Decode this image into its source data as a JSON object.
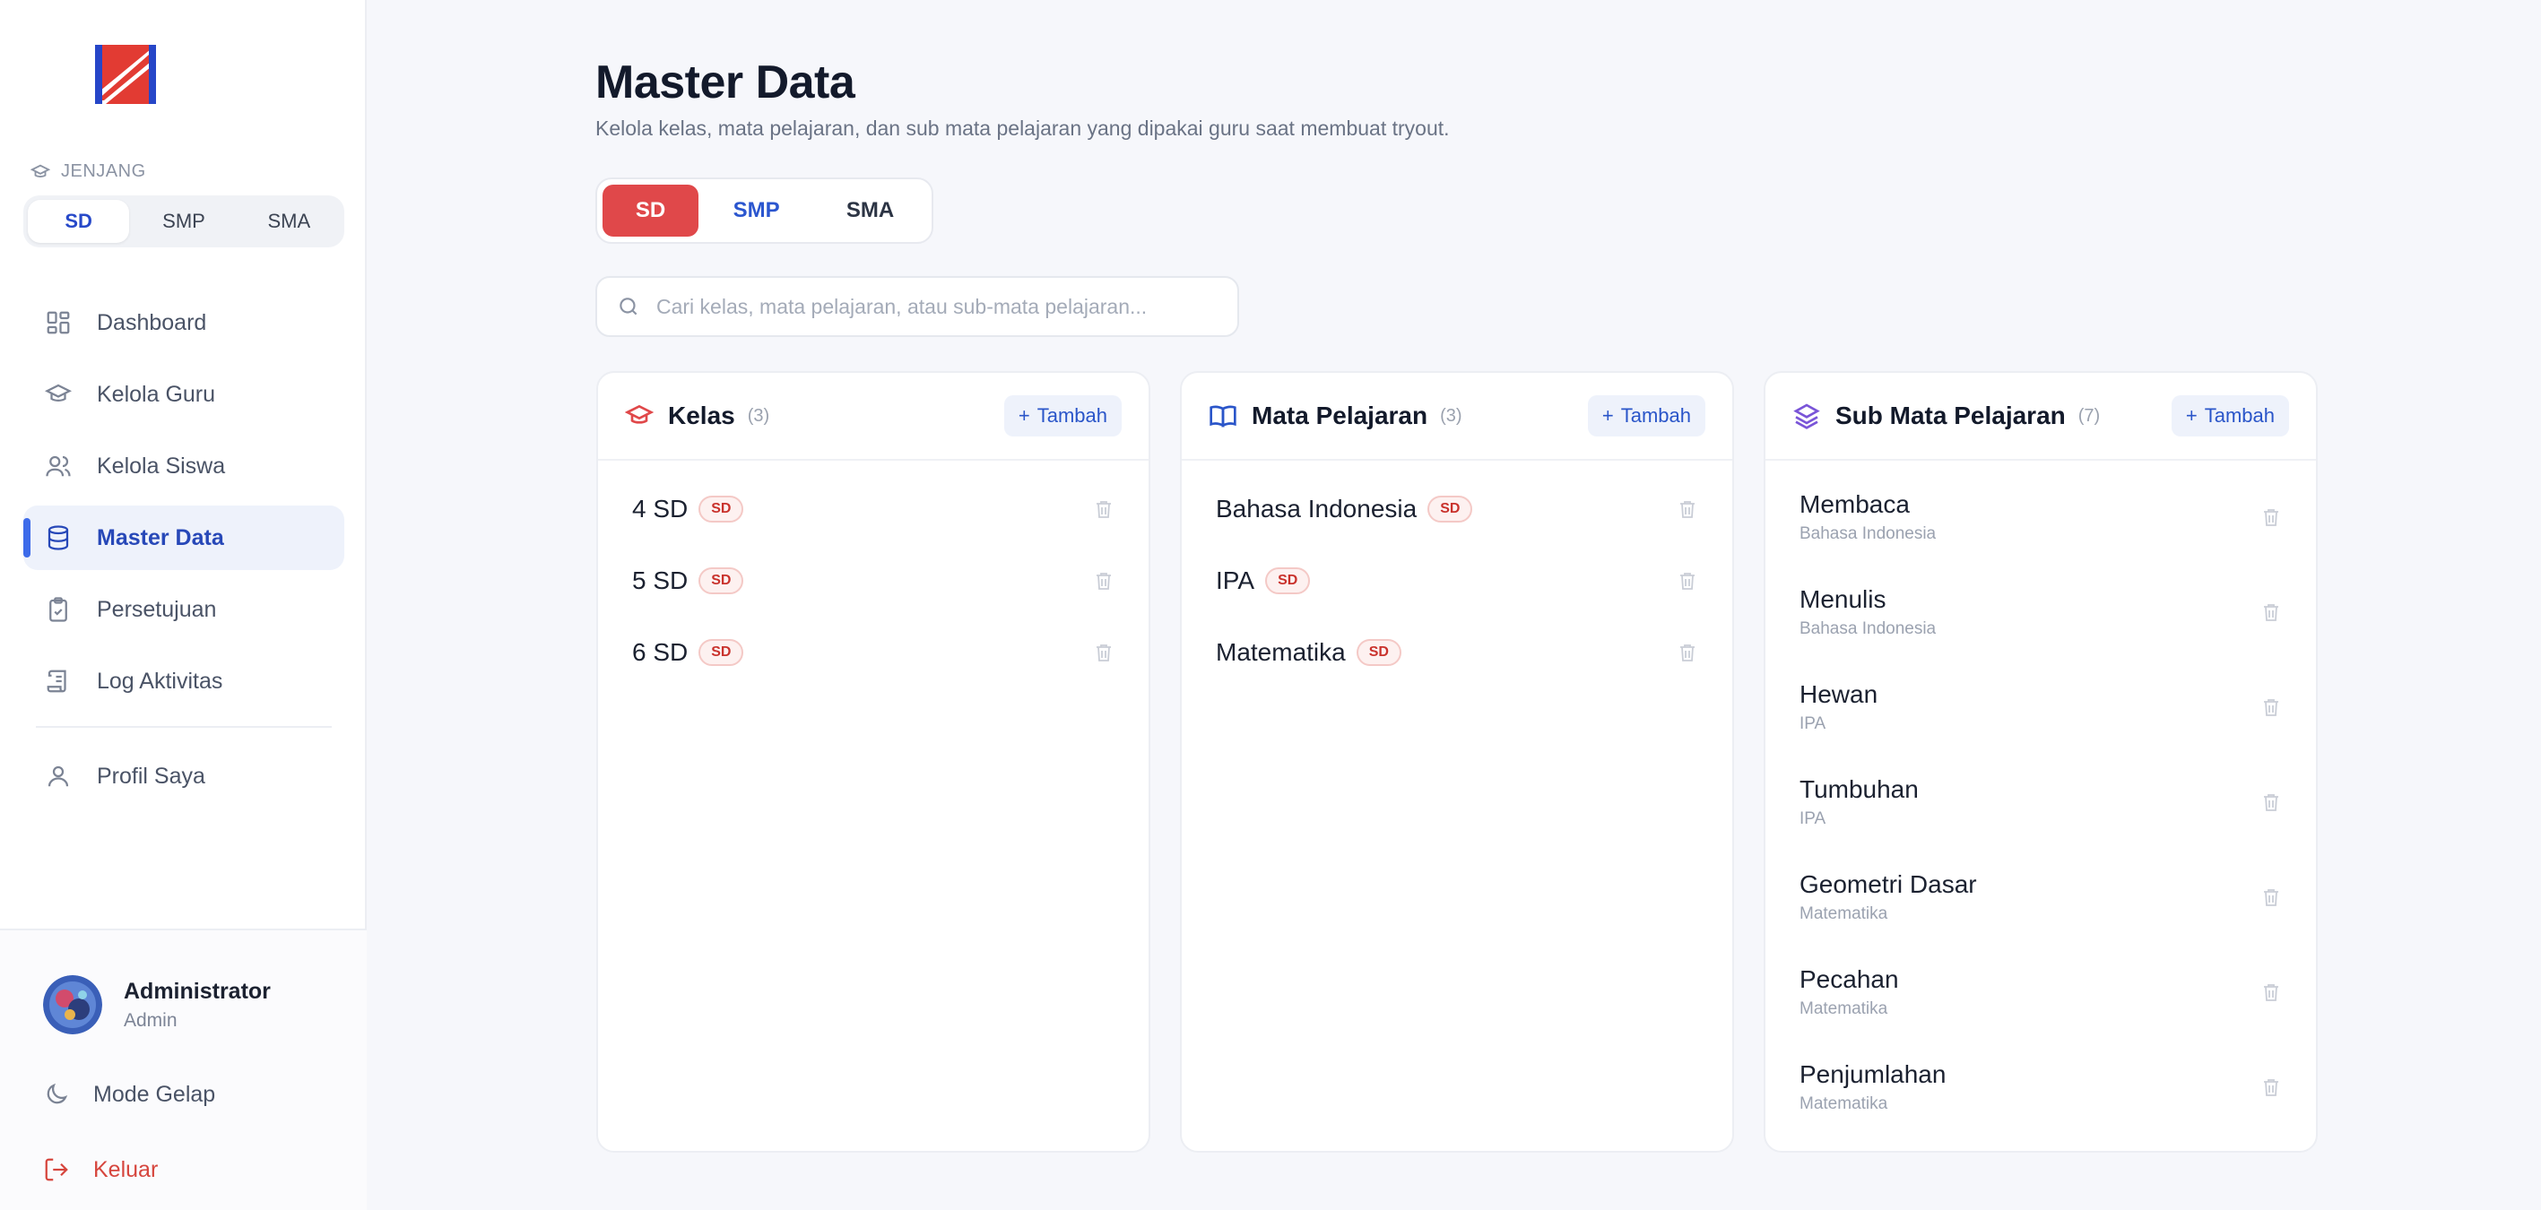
{
  "sidebar": {
    "jenjang_label": "JENJANG",
    "jenjang": [
      "SD",
      "SMP",
      "SMA"
    ],
    "nav": [
      {
        "label": "Dashboard",
        "icon": "dashboard-icon"
      },
      {
        "label": "Kelola Guru",
        "icon": "graduation-cap-icon"
      },
      {
        "label": "Kelola Siswa",
        "icon": "users-icon"
      },
      {
        "label": "Master Data",
        "icon": "database-icon",
        "active": true
      },
      {
        "label": "Persetujuan",
        "icon": "clipboard-check-icon"
      },
      {
        "label": "Log Aktivitas",
        "icon": "scroll-icon"
      },
      {
        "label": "Profil Saya",
        "icon": "user-icon"
      }
    ],
    "user": {
      "name": "Administrator",
      "role": "Admin"
    },
    "dark_mode": "Mode Gelap",
    "logout": "Keluar"
  },
  "page": {
    "title": "Master Data",
    "subtitle": "Kelola kelas, mata pelajaran, dan sub mata pelajaran yang dipakai guru saat membuat tryout."
  },
  "tabs": [
    "SD",
    "SMP",
    "SMA"
  ],
  "search": {
    "placeholder": "Cari kelas, mata pelajaran, atau sub-mata pelajaran..."
  },
  "colors": {
    "accent": "#e0484a",
    "primary": "#2a55c9",
    "purple": "#7a55d8"
  },
  "cards": {
    "kelas": {
      "title": "Kelas",
      "count": "(3)",
      "add": "Tambah",
      "items": [
        {
          "label": "4 SD",
          "badge": "SD"
        },
        {
          "label": "5 SD",
          "badge": "SD"
        },
        {
          "label": "6 SD",
          "badge": "SD"
        }
      ]
    },
    "mapel": {
      "title": "Mata Pelajaran",
      "count": "(3)",
      "add": "Tambah",
      "items": [
        {
          "label": "Bahasa Indonesia",
          "badge": "SD"
        },
        {
          "label": "IPA",
          "badge": "SD"
        },
        {
          "label": "Matematika",
          "badge": "SD"
        }
      ]
    },
    "sub": {
      "title": "Sub Mata Pelajaran",
      "count": "(7)",
      "add": "Tambah",
      "items": [
        {
          "name": "Membaca",
          "parent": "Bahasa Indonesia"
        },
        {
          "name": "Menulis",
          "parent": "Bahasa Indonesia"
        },
        {
          "name": "Hewan",
          "parent": "IPA"
        },
        {
          "name": "Tumbuhan",
          "parent": "IPA"
        },
        {
          "name": "Geometri Dasar",
          "parent": "Matematika"
        },
        {
          "name": "Pecahan",
          "parent": "Matematika"
        },
        {
          "name": "Penjumlahan",
          "parent": "Matematika"
        }
      ]
    }
  }
}
